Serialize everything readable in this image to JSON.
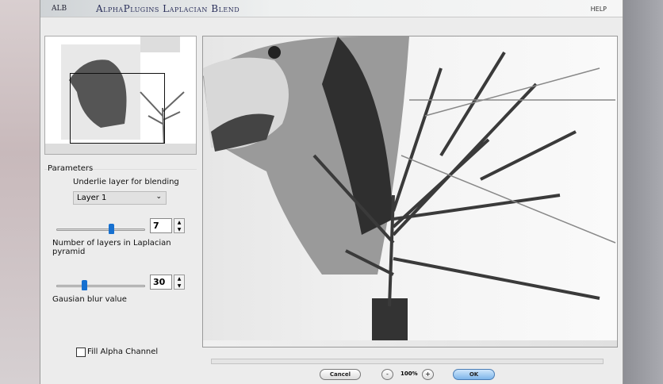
{
  "title": {
    "logo": "ALB",
    "text": "AlphaPlugins Laplacian Blend",
    "help": "HELP"
  },
  "parameters": {
    "heading": "Parameters",
    "underlie_label": "Underlie layer for blending",
    "underlie_value": "Layer 1",
    "layers_value": "7",
    "layers_label": "Number of layers in Laplacian pyramid",
    "layers_slider_fraction": 0.6,
    "blur_value": "30",
    "blur_label": "Gausian blur value",
    "blur_slider_fraction": 0.3,
    "fill_alpha_label": "Fill Alpha Channel",
    "fill_alpha_checked": false
  },
  "footer": {
    "cancel": "Cancel",
    "zoom_out": "-",
    "zoom": "100%",
    "zoom_in": "+",
    "ok": "OK"
  },
  "colors": {
    "accent": "#1670d0",
    "ok_button": "#8fc3ef"
  }
}
